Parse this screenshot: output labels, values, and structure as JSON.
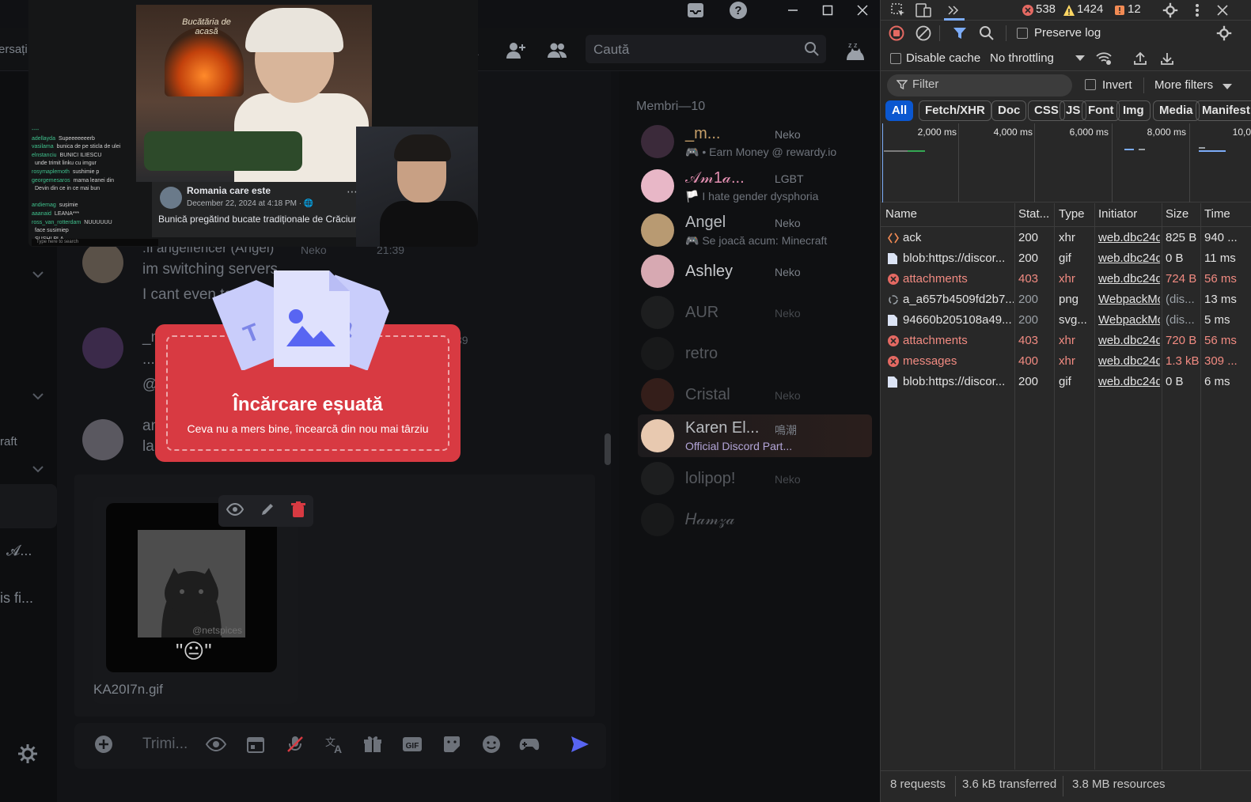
{
  "discord": {
    "search_placeholder": "Caută",
    "left_fragments": [
      "ersați",
      "raft",
      "𝓐...",
      "is fi..."
    ],
    "messages": [
      {
        "author": ".ıl angelfencer (Angel)",
        "tag": "Neko",
        "time": "21:39",
        "lines": [
          "im switching servers",
          "I cant even ta"
        ]
      },
      {
        "author": "_n",
        "time": "39",
        "lines": [
          "...",
          "@"
        ]
      },
      {
        "author": "",
        "lines": [
          "an",
          "la"
        ]
      }
    ],
    "attachment": {
      "caption": "\"😐\"",
      "watermark": "@netspices",
      "filename": "KA20I7n.gif"
    },
    "composer_placeholder": "Trimi...",
    "members": {
      "title": "Membri—10",
      "list": [
        {
          "name": "_m...",
          "tag": "Neko",
          "sub": "🎮 • Earn Money @ rewardy.io",
          "color": "#c7a06a",
          "dim": false
        },
        {
          "name": "𝒜𝓂1𝒶...",
          "tag": "LGBT",
          "sub": "🏳️ I hate gender dysphoria",
          "color": "#e38fb1",
          "dim": false
        },
        {
          "name": "Angel",
          "tag": "Neko",
          "sub": "🎮 Se joacă acum: Minecraft",
          "color": "#b8bbbf",
          "dim": false
        },
        {
          "name": "Ashley",
          "tag": "Neko",
          "sub": "",
          "color": "#c8cacd",
          "dim": false
        },
        {
          "name": "AUR",
          "tag": "Neko",
          "sub": "",
          "color": "#55585d",
          "dim": true
        },
        {
          "name": "retro",
          "tag": "",
          "sub": "",
          "color": "#55585d",
          "dim": true
        },
        {
          "name": "Cristal",
          "tag": "Neko",
          "sub": "",
          "color": "#55585d",
          "dim": true
        },
        {
          "name": "Karen El...",
          "tag": "鳴潮",
          "sub": "Official Discord Part...",
          "color": "#b8bbbf",
          "dim": false
        },
        {
          "name": "lolipop!",
          "tag": "Neko",
          "sub": "",
          "color": "#55585d",
          "dim": true
        },
        {
          "name": "𝐻𝒶𝓂𝓏𝒶",
          "tag": "",
          "sub": "",
          "color": "#55585d",
          "dim": true
        }
      ]
    }
  },
  "stream": {
    "post_author": "Romania care este",
    "post_date": "December 22, 2024 at 4:18 PM · 🌐",
    "post_text": "Bunică pregătind bucate tradiționale de Crăciun,",
    "oven_sign": "Bucătăria de acasă",
    "chat_lines": [
      {
        "user": "----",
        "text": ""
      },
      {
        "user": "adellayda",
        "text": "Supeeeeeeerb"
      },
      {
        "user": "vasilama",
        "text": "bunica de pe sticla de ulei"
      },
      {
        "user": "elnstanciu",
        "text": "BUNICI ILIESCU"
      },
      {
        "user": "",
        "text": "unde trimit linku cu imgur"
      },
      {
        "user": "rosymaplemoth",
        "text": "sushimie p"
      },
      {
        "user": "georgemesaros",
        "text": "mama leanei din"
      },
      {
        "user": "",
        "text": "Devin din ce in ce mai bun"
      },
      {
        "user": "",
        "text": ""
      },
      {
        "user": "andiemag",
        "text": "sușimie"
      },
      {
        "user": "aaanaid",
        "text": "LEANA***"
      },
      {
        "user": "ross_van_rotterdam",
        "text": "NUUUUUU"
      },
      {
        "user": "",
        "text": "face susimiep"
      },
      {
        "user": "",
        "text": "SUSHI PLA"
      }
    ],
    "chat_input_placeholder": "Type here to search"
  },
  "upload_error": {
    "title": "Încărcare eșuată",
    "subtitle": "Ceva nu a mers bine, încearcă din nou mai târziu"
  },
  "devtools": {
    "counts": {
      "errors": "538",
      "warnings": "1424",
      "issues": "12"
    },
    "preserve_log": "Preserve log",
    "disable_cache": "Disable cache",
    "throttling": "No throttling",
    "filter_placeholder": "Filter",
    "invert": "Invert",
    "more_filters": "More filters",
    "type_filters": [
      "All",
      "Fetch/XHR",
      "Doc",
      "CSS",
      "JS",
      "Font",
      "Img",
      "Media",
      "Manifest"
    ],
    "timeline_ticks": [
      "2,000 ms",
      "4,000 ms",
      "6,000 ms",
      "8,000 ms",
      "10,0"
    ],
    "columns": [
      "Name",
      "Stat...",
      "Type",
      "Initiator",
      "Size",
      "Time"
    ],
    "rows": [
      {
        "icon": "xhr",
        "name": "ack",
        "status": "200",
        "type": "xhr",
        "initiator": "web.dbc24d",
        "size": "825 B",
        "time": "940 ...",
        "error": false
      },
      {
        "icon": "doc",
        "name": "blob:https://discor...",
        "status": "200",
        "type": "gif",
        "initiator": "web.dbc24d",
        "size": "0 B",
        "time": "11 ms",
        "error": false
      },
      {
        "icon": "err",
        "name": "attachments",
        "status": "403",
        "type": "xhr",
        "initiator": "web.dbc24d",
        "size": "724 B",
        "time": "56 ms",
        "error": true
      },
      {
        "icon": "img",
        "name": "a_a657b4509fd2b7...",
        "status": "200",
        "type": "png",
        "initiator": "WebpackMo",
        "size": "(dis...",
        "time": "13 ms",
        "error": false
      },
      {
        "icon": "doc",
        "name": "94660b205108a49...",
        "status": "200",
        "type": "svg...",
        "initiator": "WebpackMo",
        "size": "(dis...",
        "time": "5 ms",
        "error": false
      },
      {
        "icon": "err",
        "name": "attachments",
        "status": "403",
        "type": "xhr",
        "initiator": "web.dbc24d",
        "size": "720 B",
        "time": "56 ms",
        "error": true
      },
      {
        "icon": "err",
        "name": "messages",
        "status": "400",
        "type": "xhr",
        "initiator": "web.dbc24d",
        "size": "1.3 kB",
        "time": "309 ...",
        "error": true
      },
      {
        "icon": "doc",
        "name": "blob:https://discor...",
        "status": "200",
        "type": "gif",
        "initiator": "web.dbc24d",
        "size": "0 B",
        "time": "6 ms",
        "error": false
      }
    ],
    "summary": {
      "requests": "8 requests",
      "transferred": "3.6 kB transferred",
      "resources": "3.8 MB resources"
    }
  }
}
